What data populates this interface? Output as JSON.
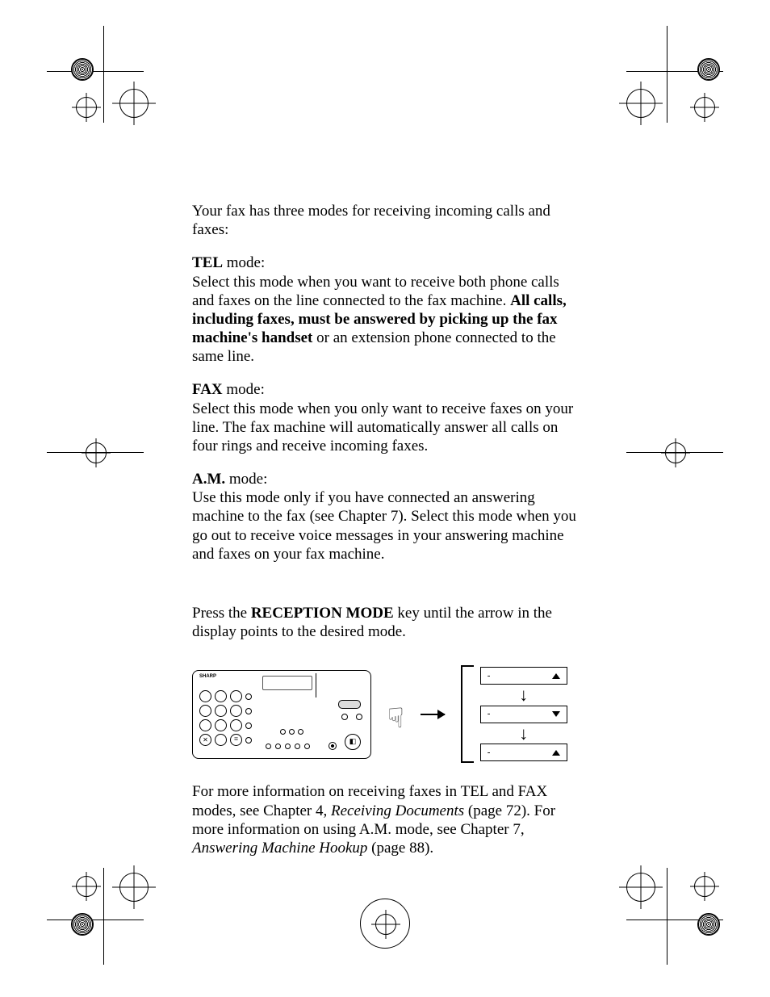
{
  "intro": "Your fax has three modes for receiving incoming calls and faxes:",
  "modes": {
    "tel": {
      "name": "TEL",
      "label_suffix": " mode:",
      "desc_before_bold": "Select this mode when you want to receive both phone calls and faxes on the line connected to the fax machine. ",
      "bold_part": "All calls, including faxes, must be answered by picking up the fax machine's handset",
      "desc_after_bold": " or an extension phone connected to the same line."
    },
    "fax": {
      "name": "FAX",
      "label_suffix": " mode:",
      "desc": "Select this mode when you only want to receive faxes on your line. The fax machine will automatically answer all calls on four rings and receive incoming faxes."
    },
    "am": {
      "name": "A.M.",
      "label_suffix": " mode:",
      "desc": "Use this mode only if you have connected an answering machine to the fax (see Chapter 7). Select this mode when you go out to receive voice messages in your answering machine and faxes on your fax machine."
    }
  },
  "press_instruction": {
    "before_key": "Press the ",
    "key_name": "RECEPTION MODE",
    "after_key": " key until the arrow in the display points to the desired mode."
  },
  "diagram": {
    "brand": "SHARP",
    "finger_icon": "☟",
    "state_dash": "-",
    "states": [
      {
        "indicator": "up"
      },
      {
        "indicator": "down"
      },
      {
        "indicator": "up"
      }
    ],
    "down_arrow_glyph": "↓"
  },
  "footer": {
    "part1": "For more information on receiving faxes in TEL and FAX modes, see Chapter 4, ",
    "italic1": "Receiving Documents",
    "part2": " (page 72). For more information on using A.M. mode, see Chapter 7, ",
    "italic2": "Answering Machine Hookup",
    "part3": " (page 88)."
  }
}
